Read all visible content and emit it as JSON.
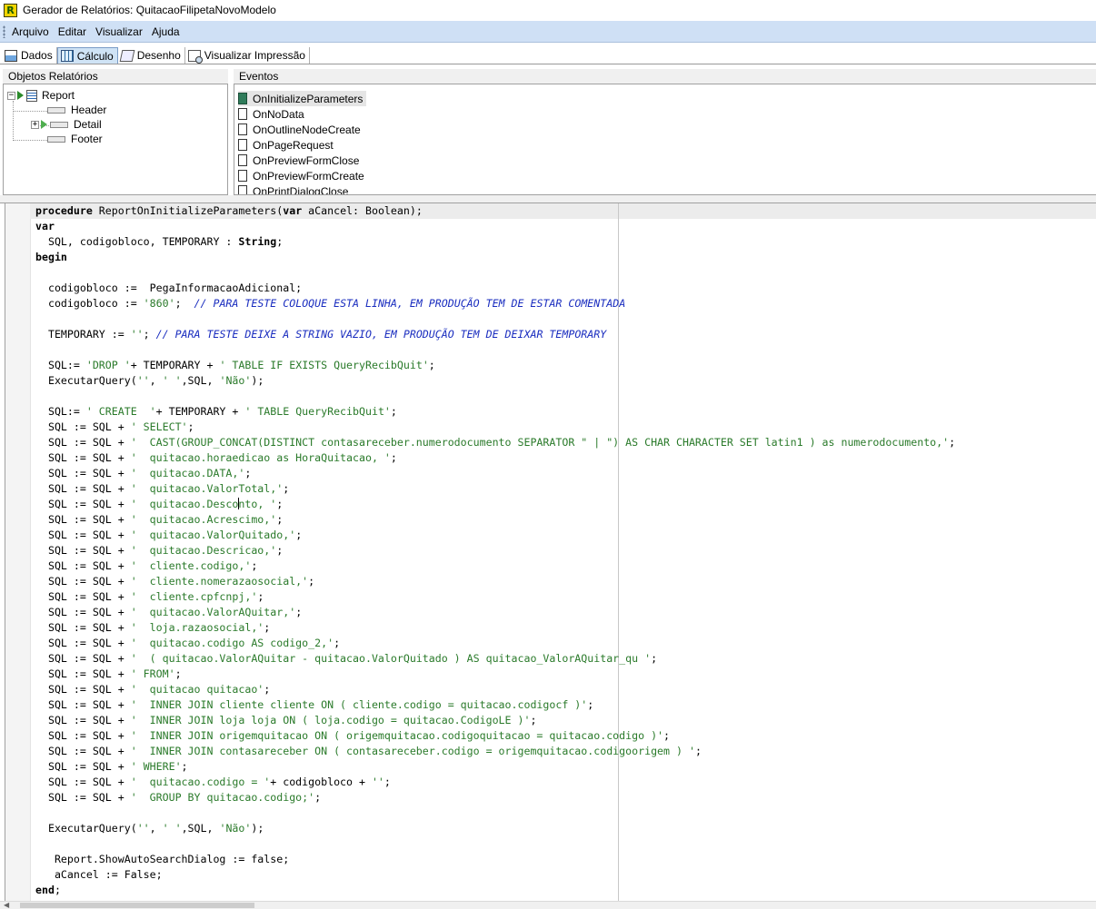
{
  "window": {
    "title": "Gerador de Relatórios: QuitacaoFilipetaNovoModelo",
    "app_icon_letter": "R"
  },
  "menu": [
    "Arquivo",
    "Editar",
    "Visualizar",
    "Ajuda"
  ],
  "tabs": [
    {
      "label": "Dados",
      "icon": "data-icon",
      "active": false
    },
    {
      "label": "Cálculo",
      "icon": "calculator-icon",
      "active": true
    },
    {
      "label": "Desenho",
      "icon": "design-icon",
      "active": false
    },
    {
      "label": "Visualizar Impressão",
      "icon": "print-preview-icon",
      "active": false
    }
  ],
  "objects_panel": {
    "header": "Objetos Relatórios",
    "tree": [
      {
        "label": "Report",
        "expander": "−"
      },
      {
        "label": "Header"
      },
      {
        "label": "Detail",
        "expander": "+"
      },
      {
        "label": "Footer"
      }
    ]
  },
  "events_panel": {
    "header": "Eventos",
    "items": [
      {
        "label": "OnInitializeParameters",
        "selected": true
      },
      {
        "label": "OnNoData"
      },
      {
        "label": "OnOutlineNodeCreate"
      },
      {
        "label": "OnPageRequest"
      },
      {
        "label": "OnPreviewFormClose"
      },
      {
        "label": "OnPreviewFormCreate"
      },
      {
        "label": "OnPrintDialogClose"
      }
    ]
  },
  "editor": {
    "lines": [
      [
        [
          "procedure",
          "kw"
        ],
        [
          " ReportOnInitializeParameters("
        ],
        [
          "var",
          "kw"
        ],
        [
          " aCancel: Boolean);"
        ]
      ],
      [
        [
          "var",
          "kw"
        ]
      ],
      [
        [
          "  SQL, codigobloco, TEMPORARY : "
        ],
        [
          "String",
          "kw"
        ],
        [
          ";"
        ]
      ],
      [
        [
          "begin",
          "kw"
        ]
      ],
      [
        [
          ""
        ]
      ],
      [
        [
          "  codigobloco :=  PegaInformacaoAdicional;"
        ]
      ],
      [
        [
          "  codigobloco := "
        ],
        [
          "'860'",
          "str"
        ],
        [
          ";  "
        ],
        [
          "// PARA TESTE COLOQUE ESTA LINHA, EM PRODUÇÃO TEM DE ESTAR COMENTADA",
          "cmt"
        ]
      ],
      [
        [
          ""
        ]
      ],
      [
        [
          "  TEMPORARY := "
        ],
        [
          "''",
          "str"
        ],
        [
          "; "
        ],
        [
          "// PARA TESTE DEIXE A STRING VAZIO, EM PRODUÇÃO TEM DE DEIXAR TEMPORARY",
          "cmt"
        ]
      ],
      [
        [
          ""
        ]
      ],
      [
        [
          "  SQL:= "
        ],
        [
          "'DROP '",
          "str"
        ],
        [
          "+ TEMPORARY + "
        ],
        [
          "' TABLE IF EXISTS QueryRecibQuit'",
          "str"
        ],
        [
          ";"
        ]
      ],
      [
        [
          "  ExecutarQuery("
        ],
        [
          "''",
          "str"
        ],
        [
          ", "
        ],
        [
          "' '",
          "str"
        ],
        [
          ",SQL, "
        ],
        [
          "'Não'",
          "str"
        ],
        [
          ");"
        ]
      ],
      [
        [
          ""
        ]
      ],
      [
        [
          "  SQL:= "
        ],
        [
          "' CREATE  '",
          "str"
        ],
        [
          "+ TEMPORARY + "
        ],
        [
          "' TABLE QueryRecibQuit'",
          "str"
        ],
        [
          ";"
        ]
      ],
      [
        [
          "  SQL := SQL + "
        ],
        [
          "' SELECT'",
          "str"
        ],
        [
          ";"
        ]
      ],
      [
        [
          "  SQL := SQL + "
        ],
        [
          "'  CAST(GROUP_CONCAT(DISTINCT contasareceber.numerodocumento SEPARATOR \" | \") AS CHAR CHARACTER SET latin1 ) as numerodocumento,'",
          "str"
        ],
        [
          ";"
        ]
      ],
      [
        [
          "  SQL := SQL + "
        ],
        [
          "'  quitacao.horaedicao as HoraQuitacao, '",
          "str"
        ],
        [
          ";"
        ]
      ],
      [
        [
          "  SQL := SQL + "
        ],
        [
          "'  quitacao.DATA,'",
          "str"
        ],
        [
          ";"
        ]
      ],
      [
        [
          "  SQL := SQL + "
        ],
        [
          "'  quitacao.ValorTotal,'",
          "str"
        ],
        [
          ";"
        ]
      ],
      [
        [
          "  SQL := SQL + "
        ],
        [
          "'  quitacao.Desco",
          "str"
        ],
        [
          "",
          "caret"
        ],
        [
          "nto, '",
          "str"
        ],
        [
          ";"
        ]
      ],
      [
        [
          "  SQL := SQL + "
        ],
        [
          "'  quitacao.Acrescimo,'",
          "str"
        ],
        [
          ";"
        ]
      ],
      [
        [
          "  SQL := SQL + "
        ],
        [
          "'  quitacao.ValorQuitado,'",
          "str"
        ],
        [
          ";"
        ]
      ],
      [
        [
          "  SQL := SQL + "
        ],
        [
          "'  quitacao.Descricao,'",
          "str"
        ],
        [
          ";"
        ]
      ],
      [
        [
          "  SQL := SQL + "
        ],
        [
          "'  cliente.codigo,'",
          "str"
        ],
        [
          ";"
        ]
      ],
      [
        [
          "  SQL := SQL + "
        ],
        [
          "'  cliente.nomerazaosocial,'",
          "str"
        ],
        [
          ";"
        ]
      ],
      [
        [
          "  SQL := SQL + "
        ],
        [
          "'  cliente.cpfcnpj,'",
          "str"
        ],
        [
          ";"
        ]
      ],
      [
        [
          "  SQL := SQL + "
        ],
        [
          "'  quitacao.ValorAQuitar,'",
          "str"
        ],
        [
          ";"
        ]
      ],
      [
        [
          "  SQL := SQL + "
        ],
        [
          "'  loja.razaosocial,'",
          "str"
        ],
        [
          ";"
        ]
      ],
      [
        [
          "  SQL := SQL + "
        ],
        [
          "'  quitacao.codigo AS codigo_2,'",
          "str"
        ],
        [
          ";"
        ]
      ],
      [
        [
          "  SQL := SQL + "
        ],
        [
          "'  ( quitacao.ValorAQuitar - quitacao.ValorQuitado ) AS quitacao_ValorAQuitar_qu '",
          "str"
        ],
        [
          ";"
        ]
      ],
      [
        [
          "  SQL := SQL + "
        ],
        [
          "' FROM'",
          "str"
        ],
        [
          ";"
        ]
      ],
      [
        [
          "  SQL := SQL + "
        ],
        [
          "'  quitacao quitacao'",
          "str"
        ],
        [
          ";"
        ]
      ],
      [
        [
          "  SQL := SQL + "
        ],
        [
          "'  INNER JOIN cliente cliente ON ( cliente.codigo = quitacao.codigocf )'",
          "str"
        ],
        [
          ";"
        ]
      ],
      [
        [
          "  SQL := SQL + "
        ],
        [
          "'  INNER JOIN loja loja ON ( loja.codigo = quitacao.CodigoLE )'",
          "str"
        ],
        [
          ";"
        ]
      ],
      [
        [
          "  SQL := SQL + "
        ],
        [
          "'  INNER JOIN origemquitacao ON ( origemquitacao.codigoquitacao = quitacao.codigo )'",
          "str"
        ],
        [
          ";"
        ]
      ],
      [
        [
          "  SQL := SQL + "
        ],
        [
          "'  INNER JOIN contasareceber ON ( contasareceber.codigo = origemquitacao.codigoorigem ) '",
          "str"
        ],
        [
          ";"
        ]
      ],
      [
        [
          "  SQL := SQL + "
        ],
        [
          "' WHERE'",
          "str"
        ],
        [
          ";"
        ]
      ],
      [
        [
          "  SQL := SQL + "
        ],
        [
          "'  quitacao.codigo = '",
          "str"
        ],
        [
          "+ codigobloco + "
        ],
        [
          "''",
          "str"
        ],
        [
          ";"
        ]
      ],
      [
        [
          "  SQL := SQL + "
        ],
        [
          "'  GROUP BY quitacao.codigo;'",
          "str"
        ],
        [
          ";"
        ]
      ],
      [
        [
          ""
        ]
      ],
      [
        [
          "  ExecutarQuery("
        ],
        [
          "''",
          "str"
        ],
        [
          ", "
        ],
        [
          "' '",
          "str"
        ],
        [
          ",SQL, "
        ],
        [
          "'Não'",
          "str"
        ],
        [
          ");"
        ]
      ],
      [
        [
          ""
        ]
      ],
      [
        [
          "   Report.ShowAutoSearchDialog := false;"
        ]
      ],
      [
        [
          "   aCancel := False;"
        ]
      ],
      [
        [
          "end",
          "kw"
        ],
        [
          ";"
        ]
      ]
    ]
  }
}
